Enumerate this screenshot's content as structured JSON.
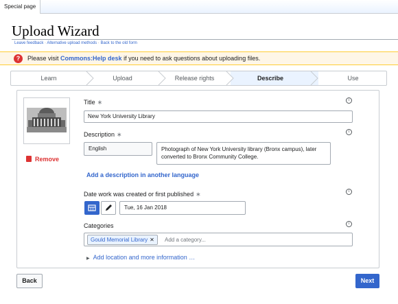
{
  "tab": {
    "label": "Special page"
  },
  "page": {
    "title": "Upload Wizard"
  },
  "links": {
    "feedback": "Leave feedback",
    "alternative": "Alternative upload methods",
    "old_form": "Back to the old form",
    "separator": "·"
  },
  "notice": {
    "before": "Please visit ",
    "link": "Commons:Help desk",
    "after": " if you need to ask questions about uploading files."
  },
  "steps": [
    {
      "label": "Learn"
    },
    {
      "label": "Upload"
    },
    {
      "label": "Release rights"
    },
    {
      "label": "Describe",
      "active": true
    },
    {
      "label": "Use"
    }
  ],
  "file": {
    "remove_label": "Remove",
    "title_label": "Title",
    "title_value": "New York University Library",
    "description_label": "Description",
    "description_language": "English",
    "description_value": "Photograph of New York University library (Bronx campus), later converted to Bronx Community College.",
    "add_description_link": "Add a description in another language",
    "date_label": "Date work was created or first published",
    "date_value": "Tue, 16 Jan 2018",
    "categories_label": "Categories",
    "category_chip": "Gould Memorial Library",
    "category_chip_remove": "✕",
    "category_placeholder": "Add a category...",
    "more_info_link": "Add location and more information …",
    "required_mark": "∗",
    "info_mark": "i"
  },
  "buttons": {
    "back": "Back",
    "next": "Next"
  },
  "colors": {
    "accent": "#3366cc",
    "destructive": "#d33",
    "notice_bg": "#fef6e7",
    "active_step_bg": "#eaf3ff"
  }
}
